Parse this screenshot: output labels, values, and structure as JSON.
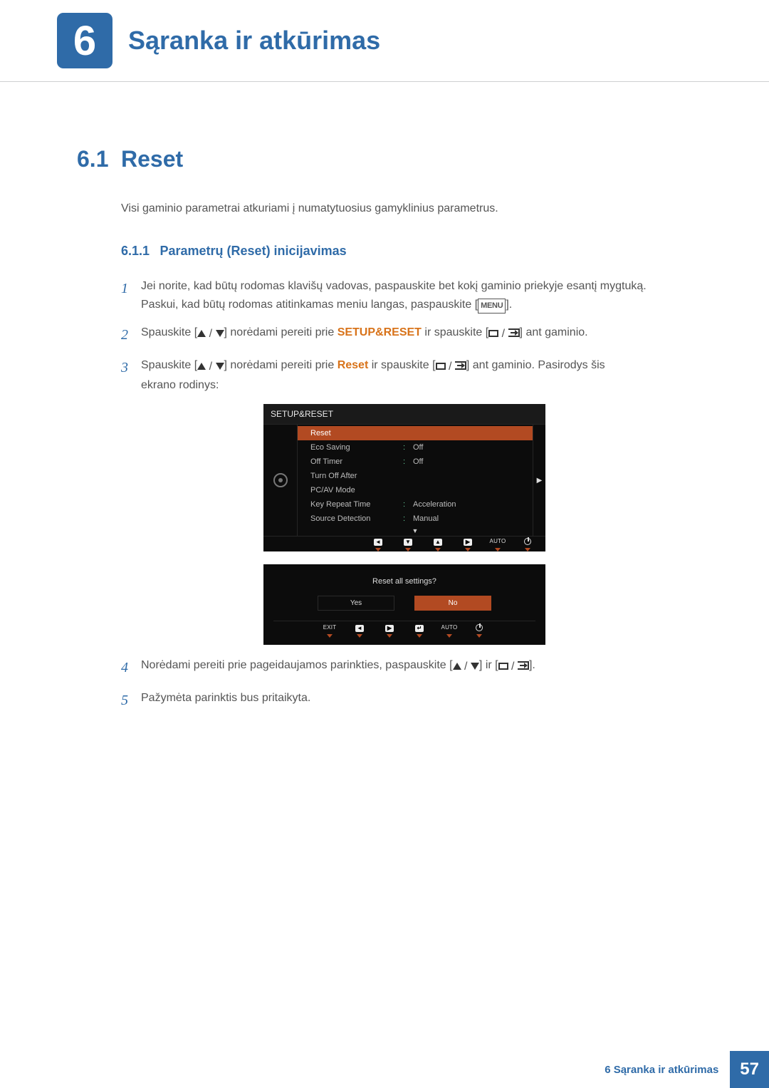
{
  "chapter": {
    "number": "6",
    "title": "Sąranka ir atkūrimas"
  },
  "section": {
    "number": "6.1",
    "title": "Reset"
  },
  "intro": "Visi gaminio parametrai atkuriami į numatytuosius gamyklinius parametrus.",
  "subsection": {
    "number": "6.1.1",
    "title": "Parametrų (Reset) inicijavimas"
  },
  "steps": {
    "s1": {
      "n": "1",
      "l1": "Jei norite, kad būtų rodomas klavišų vadovas, paspauskite bet kokį gaminio priekyje esantį mygtuką.",
      "l2a": "Paskui, kad būtų rodomas atitinkamas meniu langas, paspauskite [",
      "menu": "MENU",
      "l2b": "]."
    },
    "s2": {
      "n": "2",
      "a": "Spauskite [",
      "b": "] norėdami pereiti prie ",
      "setup": "SETUP&RESET",
      "c": " ir spauskite [",
      "d": "] ant gaminio."
    },
    "s3": {
      "n": "3",
      "a": "Spauskite [",
      "b": "] norėdami pereiti prie ",
      "reset": "Reset",
      "c": " ir spauskite [",
      "d": "] ant gaminio. Pasirodys šis",
      "e": "ekrano rodinys:"
    },
    "s4": {
      "n": "4",
      "a": "Norėdami pereiti prie pageidaujamos parinkties, paspauskite [",
      "b": "] ir [",
      "c": "]."
    },
    "s5": {
      "n": "5",
      "a": "Pažymėta parinktis bus pritaikyta."
    }
  },
  "osd1": {
    "header": "SETUP&RESET",
    "items": [
      {
        "label": "Reset",
        "val": ""
      },
      {
        "label": "Eco Saving",
        "val": "Off"
      },
      {
        "label": "Off Timer",
        "val": "Off"
      },
      {
        "label": "Turn Off After",
        "val": ""
      },
      {
        "label": "PC/AV Mode",
        "val": ""
      },
      {
        "label": "Key Repeat Time",
        "val": "Acceleration"
      },
      {
        "label": "Source Detection",
        "val": "Manual"
      }
    ],
    "nav_auto": "AUTO"
  },
  "osd2": {
    "question": "Reset all settings?",
    "yes": "Yes",
    "no": "No",
    "exit": "EXIT",
    "auto": "AUTO"
  },
  "footer": {
    "text": "6 Sąranka ir atkūrimas",
    "page": "57"
  }
}
